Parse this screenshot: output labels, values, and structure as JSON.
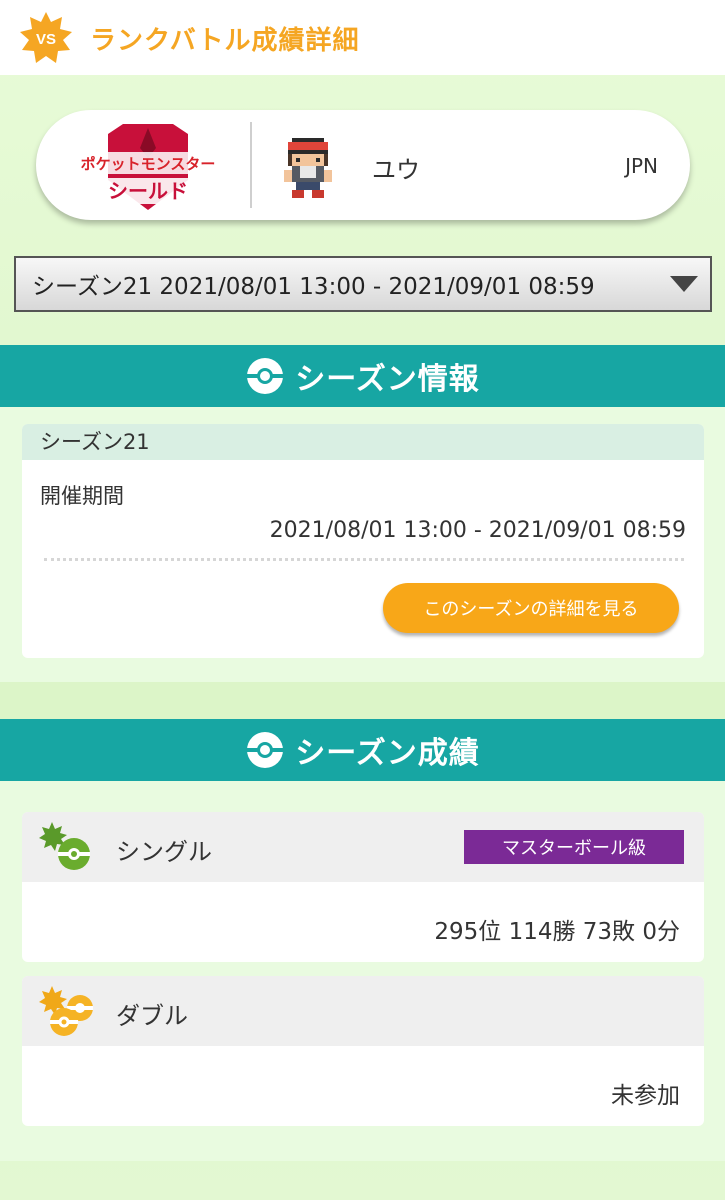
{
  "header": {
    "badge_text": "VS",
    "title": "ランクバトル成績詳細"
  },
  "trainer": {
    "game_logo": {
      "line1": "ポケットモンスター",
      "line2": "シールド"
    },
    "name": "ユウ",
    "region": "JPN"
  },
  "season_select": {
    "selected": "シーズン21 2021/08/01 13:00 - 2021/09/01 08:59"
  },
  "season_info": {
    "section_title": "シーズン情報",
    "season_name": "シーズン21",
    "period_label": "開催期間",
    "period_value": "2021/08/01 13:00 - 2021/09/01 08:59",
    "detail_button": "このシーズンの詳細を見る"
  },
  "season_results": {
    "section_title": "シーズン成績",
    "single": {
      "name": "シングル",
      "rank_class": "マスターボール級",
      "record": "295位 114勝 73敗 0分"
    },
    "double": {
      "name": "ダブル",
      "record": "未参加"
    }
  },
  "colors": {
    "accent_orange": "#f5a623",
    "teal": "#17a6a3",
    "master_purple": "#7b2a96",
    "button_orange": "#f8a718",
    "shield_red": "#c8103a"
  },
  "icons": {
    "header": "vs-badge-icon",
    "dropdown": "triangle-down-icon",
    "section": "poke-ball-icon",
    "single": "single-battle-icon",
    "double": "double-battle-icon"
  }
}
